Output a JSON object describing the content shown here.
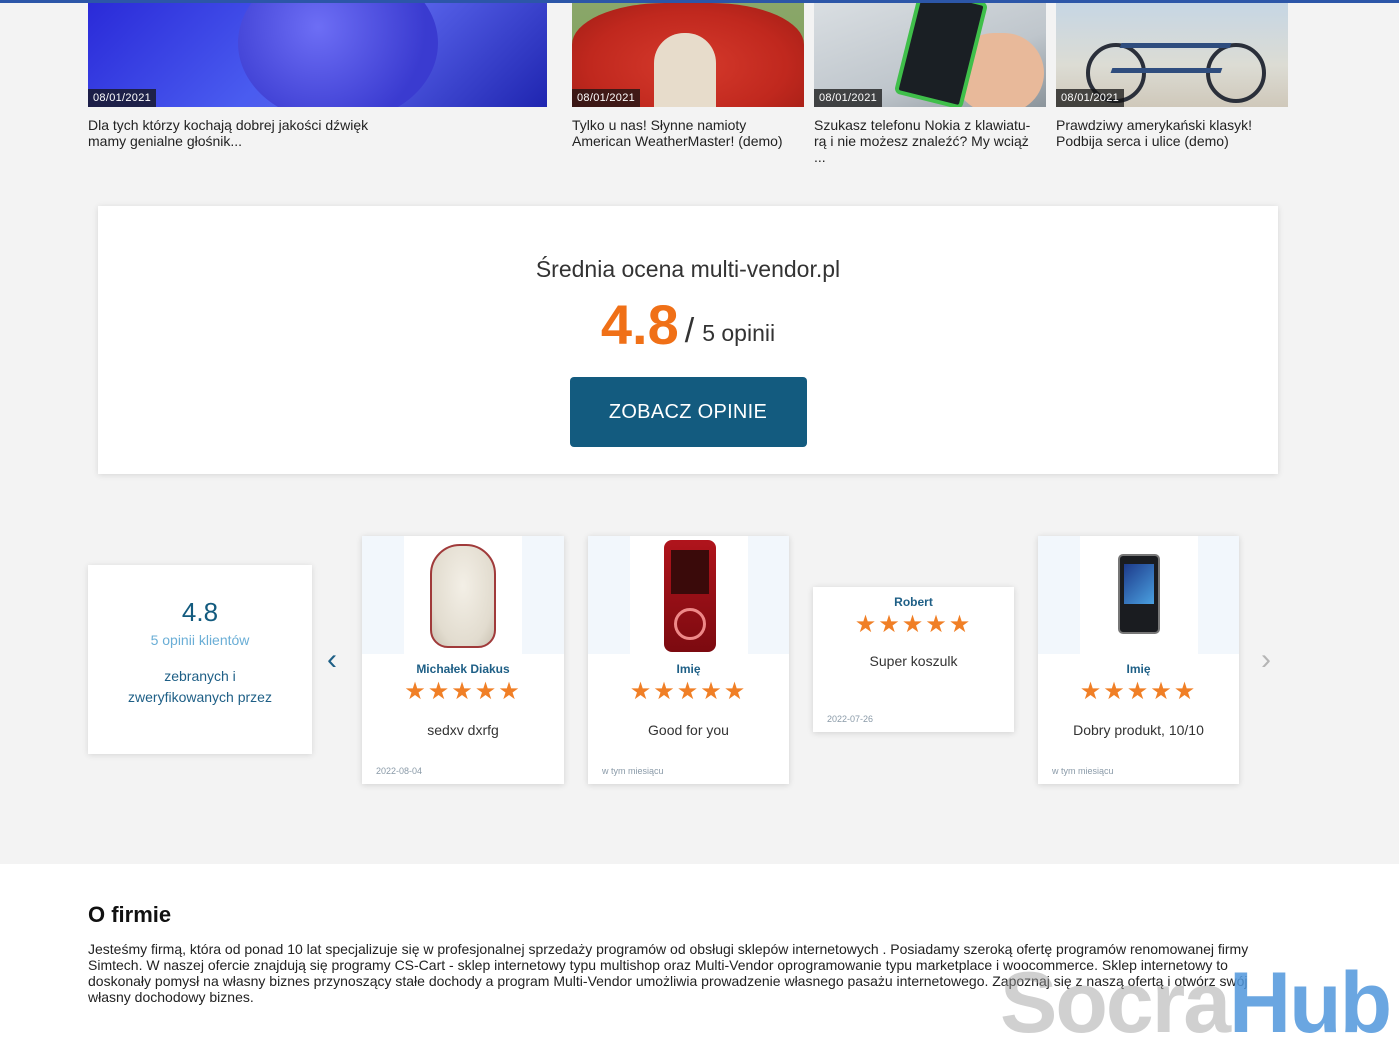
{
  "blog": {
    "items": [
      {
        "date": "08/01/2021",
        "title": "Dla tych którzy kochają dobrej jakości dźwięk mamy genialne głośnik..."
      },
      {
        "date": "08/01/2021",
        "title": "Tylko u nas! Słynne namioty American WeatherMaster! (demo)"
      },
      {
        "date": "08/01/2021",
        "title": "Szukasz telefonu Nokia z klawiatu- rą i nie możesz znaleźć? My wciąż ..."
      },
      {
        "date": "08/01/2021",
        "title": "Prawdziwy amerykański klasyk! Podbija serca i ulice (demo)"
      }
    ]
  },
  "rating": {
    "title": "Średnia ocena multi-vendor.pl",
    "score": "4.8",
    "slash": "/",
    "count": "5 opinii",
    "button": "ZOBACZ OPINIE"
  },
  "summary": {
    "score": "4.8",
    "sub": "5 opinii klientów",
    "line1": "zebranych i",
    "line2": "zweryfikowanych przez"
  },
  "arrows": {
    "left": "‹",
    "right": "›"
  },
  "reviews": [
    {
      "name": "Michałek Diakus",
      "stars": "★★★★★",
      "text": "sedxv dxrfg",
      "date": "2022-08-04",
      "rating": 5
    },
    {
      "name": "Imię",
      "stars": "★★★★★",
      "text": "Good for you",
      "date": "w tym miesiącu",
      "rating": 5
    },
    {
      "name": "Robert",
      "stars": "★★★★★",
      "text": "Super koszulk",
      "date": "2022-07-26",
      "rating": 5
    },
    {
      "name": "Imię",
      "stars": "★★★★★",
      "text": "Dobry produkt, 10/10",
      "date": "w tym miesiącu",
      "rating": 5
    }
  ],
  "about": {
    "title": "O firmie",
    "text": "Jesteśmy firmą, która od ponad 10 lat specjalizuje się w profesjonalnej sprzedaży programów od obsługi sklepów internetowych . Posiadamy szeroką ofertę programów renomowanej firmy Simtech. W naszej ofercie znajdują się programy CS-Cart - sklep internetowy typu multishop oraz Multi-Vendor oprogramowanie typu marketplace i woocommerce. Sklep internetowy to doskonały pomysł na własny biznes przynoszący stałe dochody a program Multi-Vendor umożliwia prowadzenie własnego pasażu internetowego. Zapoznaj się z naszą ofertą i otwórz swój własny dochodowy biznes."
  },
  "watermark": {
    "part1": "Socra",
    "part2": "Hub"
  },
  "colors": {
    "accent_orange": "#f07017",
    "brand_blue": "#135b7f",
    "link_blue": "#6aaed6"
  }
}
